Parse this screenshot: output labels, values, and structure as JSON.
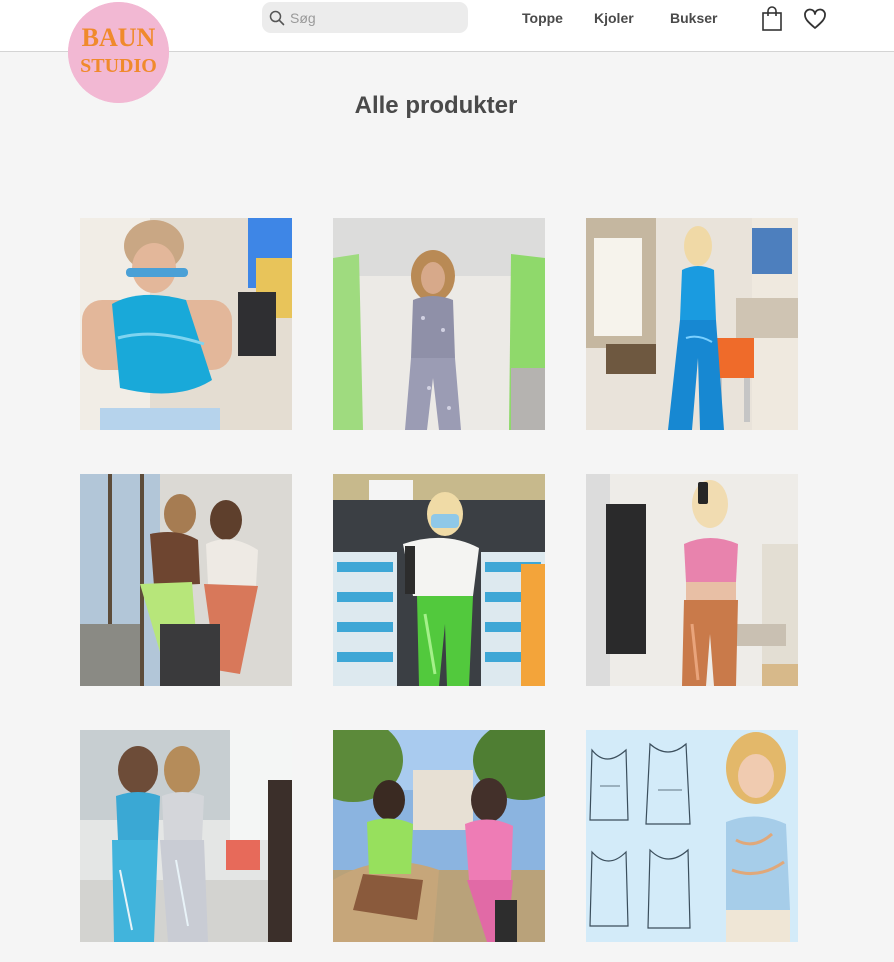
{
  "brand": {
    "logo_text_line1": "BAUN",
    "logo_text_line2": "STUDIO",
    "logo_bg": "#f2b8d3",
    "logo_text_color": "#f08a2c"
  },
  "search": {
    "placeholder": "Søg",
    "value": ""
  },
  "nav": {
    "items": [
      {
        "label": "Toppe"
      },
      {
        "label": "Kjoler"
      },
      {
        "label": "Bukser"
      }
    ]
  },
  "icons": {
    "search": "search-icon",
    "cart": "shopping-bag-icon",
    "wishlist": "heart-icon"
  },
  "main": {
    "title": "Alle produkter"
  },
  "products": [
    {
      "image": "blue sequin tank top"
    },
    {
      "image": "grey patterned top and trousers"
    },
    {
      "image": "blue sequin top and flared trousers"
    },
    {
      "image": "green sequin trousers and red sequin trousers"
    },
    {
      "image": "green sequin trousers"
    },
    {
      "image": "pink sequin crop top and copper trousers"
    },
    {
      "image": "blue sequin top and silver sequin trousers"
    },
    {
      "image": "green and pink sequin dresses"
    },
    {
      "image": "tank top sewing pattern"
    }
  ],
  "colors": {
    "header_bg": "#ffffff",
    "page_bg": "#f5f5f5",
    "text": "#4a4a4a",
    "search_bg": "#ececec"
  }
}
